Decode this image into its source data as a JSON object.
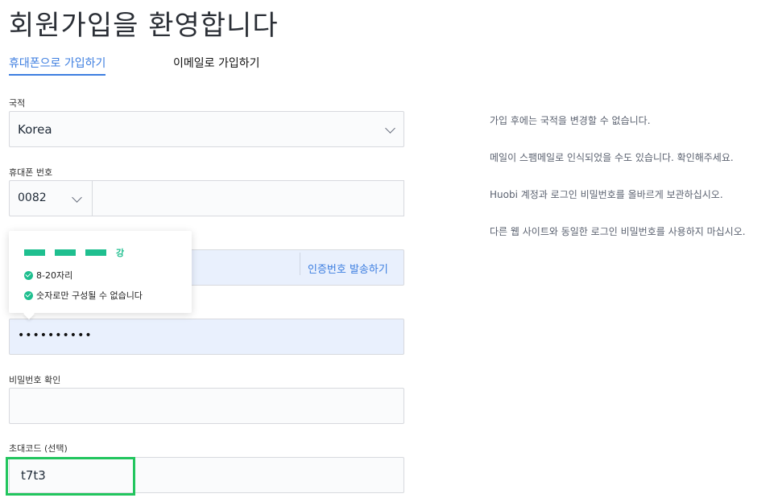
{
  "page": {
    "title": "회원가입을 환영합니다"
  },
  "tabs": {
    "phone": "휴대폰으로 가입하기",
    "email": "이메일로 가입하기"
  },
  "form": {
    "nationality_label": "국적",
    "nationality_value": "Korea",
    "phone_label": "휴대폰 번호",
    "country_code": "0082",
    "phone_value": "",
    "send_code": "인증번호 발송하기",
    "password_value": "••••••••••",
    "confirm_label": "비밀번호 확인",
    "confirm_value": "",
    "invite_label": "초대코드 (선택)",
    "invite_value": "t7t3"
  },
  "password_popup": {
    "strength": "강",
    "bars": 3,
    "rules": [
      "8-20자리",
      "숫자로만 구성될 수 없습니다"
    ]
  },
  "notes": [
    "가입 후에는 국적을 변경할 수 없습니다.",
    "메일이 스팸메일로 인식되었을 수도 있습니다. 확인해주세요.",
    "Huobi 계정과 로그인 비밀번호를 올바르게 보관하십시오.",
    "다른 웹 사이트와 동일한 로그인 비밀번호를 사용하지 마십시오."
  ],
  "colors": {
    "accent": "#3d7ee0",
    "success": "#1fbf8f",
    "highlight": "#22c55e"
  }
}
